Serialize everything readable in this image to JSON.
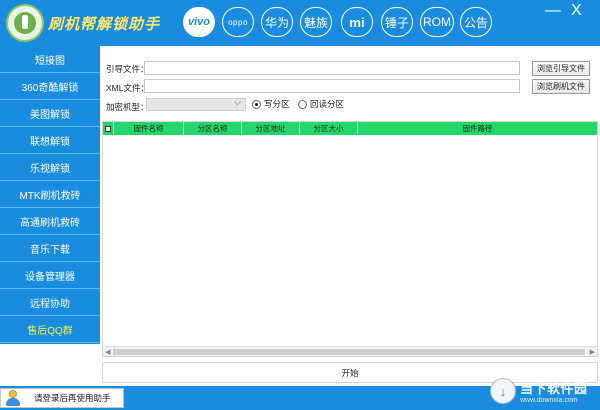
{
  "app": {
    "title": "刷机帮解锁助手"
  },
  "brands": [
    "vivo",
    "oppo",
    "华为",
    "魅族",
    "mi",
    "锤子",
    "ROM",
    "公告"
  ],
  "window": {
    "minimize": "—",
    "close": "X"
  },
  "sidebar": {
    "items": [
      {
        "label": "短接图"
      },
      {
        "label": "360奇酷解锁"
      },
      {
        "label": "美图解锁"
      },
      {
        "label": "联想解锁"
      },
      {
        "label": "乐视解锁"
      },
      {
        "label": "MTK刷机救砖"
      },
      {
        "label": "高通刷机救砖"
      },
      {
        "label": "音乐下载"
      },
      {
        "label": "设备管理器"
      },
      {
        "label": "远程协助"
      },
      {
        "label": "售后QQ群"
      }
    ]
  },
  "form": {
    "guide_label": "引导文件：",
    "guide_value": "",
    "browse_guide": "浏览引导文件",
    "xml_label": "XML文件：",
    "xml_value": "",
    "browse_firmware": "浏览刷机文件",
    "model_label": "加密机型：",
    "model_value": "",
    "radio_write": "写分区",
    "radio_read": "回读分区",
    "radio_selected": "写分区"
  },
  "table": {
    "columns": [
      "固件名称",
      "分区名称",
      "分区地址",
      "分区大小",
      "固件路径"
    ],
    "rows": []
  },
  "start_button": "开始",
  "status": {
    "login_hint": "请登录后再使用助手"
  },
  "watermark": {
    "title": "当下软件园",
    "url": "www.downxia.com"
  },
  "colors": {
    "primary": "#1a8ce0",
    "header_green": "#22d66a",
    "highlight_yellow": "#f8f04a",
    "title_yellow": "#ffe76a"
  }
}
